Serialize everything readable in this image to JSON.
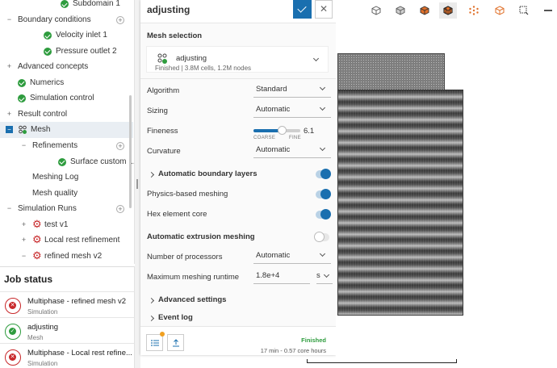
{
  "tree": [
    {
      "label": "Subdomain 1",
      "exp": "",
      "icon": "check",
      "indent": 75
    },
    {
      "label": "Boundary conditions",
      "exp": "−",
      "icon": "",
      "indent": 22
    },
    {
      "label": "Velocity inlet 1",
      "exp": "",
      "icon": "check",
      "indent": 54
    },
    {
      "label": "Pressure outlet 2",
      "exp": "",
      "icon": "check",
      "indent": 54
    },
    {
      "label": "Advanced concepts",
      "exp": "+",
      "icon": "",
      "indent": 22
    },
    {
      "label": "Numerics",
      "exp": "",
      "icon": "check",
      "indent": 22
    },
    {
      "label": "Simulation control",
      "exp": "",
      "icon": "check",
      "indent": 22
    },
    {
      "label": "Result control",
      "exp": "+",
      "icon": "",
      "indent": 22
    },
    {
      "label": "Mesh",
      "exp": "−",
      "icon": "mesh",
      "indent": 22
    },
    {
      "label": "Refinements",
      "exp": "−",
      "icon": "",
      "indent": 40
    },
    {
      "label": "Surface custom ...",
      "exp": "",
      "icon": "check",
      "indent": 72
    },
    {
      "label": "Meshing Log",
      "exp": "",
      "icon": "",
      "indent": 40
    },
    {
      "label": "Mesh quality",
      "exp": "",
      "icon": "",
      "indent": 40
    },
    {
      "label": "Simulation Runs",
      "exp": "−",
      "icon": "",
      "indent": 22
    },
    {
      "label": "test v1",
      "exp": "+",
      "icon": "gear",
      "indent": 40
    },
    {
      "label": "Local rest refinement",
      "exp": "+",
      "icon": "gear",
      "indent": 40
    },
    {
      "label": "refined mesh v2",
      "exp": "−",
      "icon": "gear",
      "indent": 40
    }
  ],
  "job_status": {
    "title": "Job status",
    "jobs": [
      {
        "title": "Multiphase - refined mesh v2",
        "sub": "Simulation",
        "state": "error"
      },
      {
        "title": "adjusting",
        "sub": "Mesh",
        "state": "ok"
      },
      {
        "title": "Multiphase - Local rest refine...",
        "sub": "Simulation",
        "state": "error"
      }
    ]
  },
  "panel": {
    "title": "adjusting",
    "mesh_selection": {
      "heading": "Mesh selection",
      "name": "adjusting",
      "sub": "Finished | 3.8M cells, 1.2M nodes"
    },
    "algorithm": {
      "label": "Algorithm",
      "value": "Standard"
    },
    "sizing": {
      "label": "Sizing",
      "value": "Automatic"
    },
    "fineness": {
      "label": "Fineness",
      "value": "6.1",
      "coarse": "COARSE",
      "fine": "FINE",
      "level": 0.61
    },
    "curvature": {
      "label": "Curvature",
      "value": "Automatic"
    },
    "auto_boundary_layers": {
      "label": "Automatic boundary layers",
      "on": true
    },
    "physics_meshing": {
      "label": "Physics-based meshing",
      "on": true
    },
    "hex_core": {
      "label": "Hex element core",
      "on": true
    },
    "auto_extrusion": {
      "label": "Automatic extrusion meshing",
      "on": false
    },
    "processors": {
      "label": "Number of processors",
      "value": "Automatic"
    },
    "runtime": {
      "label": "Maximum meshing runtime",
      "value": "1.8e+4",
      "unit": "s"
    },
    "advanced_settings": {
      "label": "Advanced settings"
    },
    "event_log": {
      "label": "Event log"
    },
    "footer": {
      "status": "Finished",
      "detail": "17 min - 0.57 core hours"
    }
  },
  "colors": {
    "accent": "#1a6faf",
    "ok": "#2e9c3e",
    "error": "#c8282a",
    "warning": "#f0a020"
  }
}
